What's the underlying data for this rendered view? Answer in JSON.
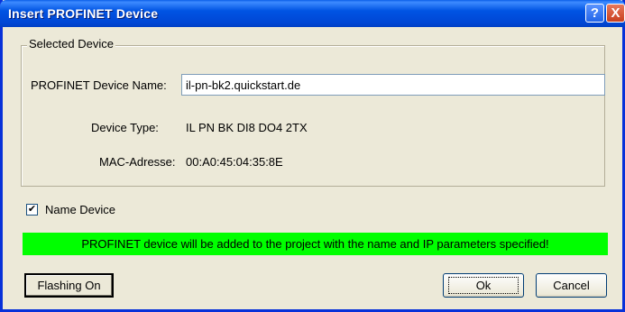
{
  "window": {
    "title": "Insert PROFINET Device",
    "help_icon_glyph": "?",
    "close_icon_glyph": "X"
  },
  "group": {
    "legend": "Selected Device",
    "device_name_label": "PROFINET Device Name:",
    "device_name_value": "il-pn-bk2.quickstart.de",
    "device_type_label": "Device Type:",
    "device_type_value": "IL PN BK DI8 DO4 2TX",
    "mac_label": "MAC-Adresse:",
    "mac_value": "00:A0:45:04:35:8E"
  },
  "name_device": {
    "label": "Name Device",
    "checked": true,
    "check_glyph": "✔"
  },
  "status": {
    "message": "PROFINET device will be added to the project with the name and IP parameters specified!",
    "color": "#00ff00"
  },
  "buttons": {
    "flashing": "Flashing On",
    "ok": "Ok",
    "cancel": "Cancel"
  }
}
